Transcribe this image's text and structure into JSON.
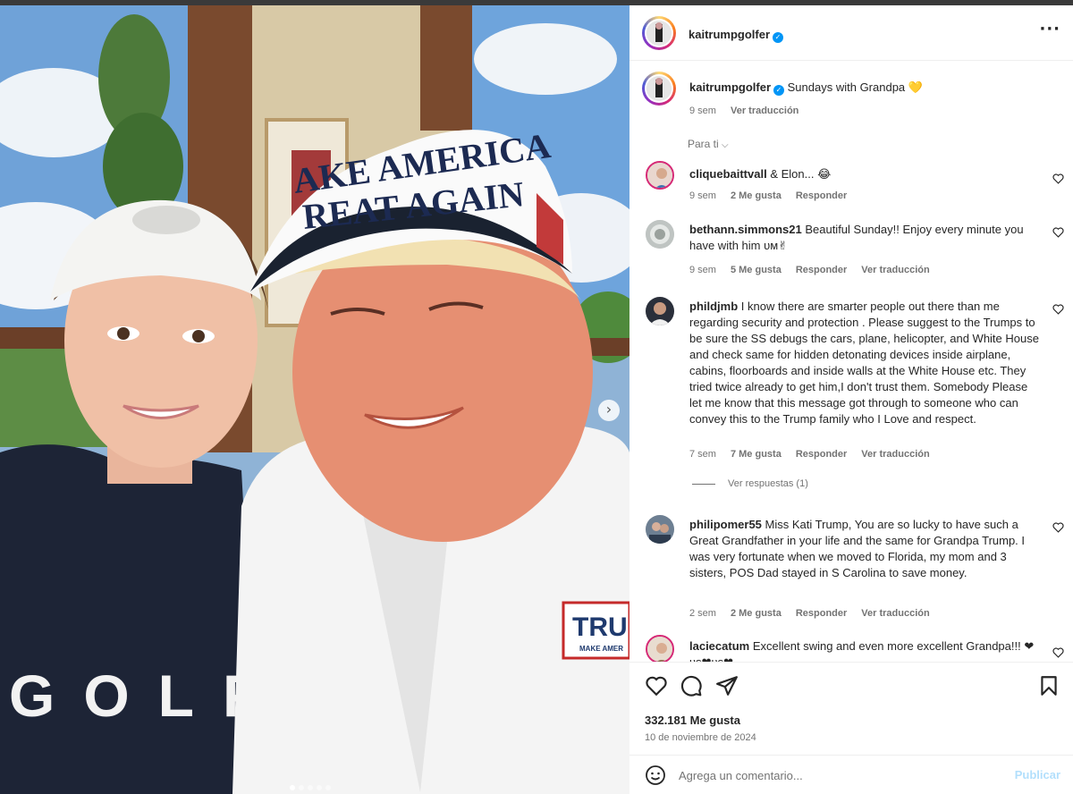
{
  "post": {
    "author": "kaitrumpgolfer",
    "caption": "Sundays with Grandpa 💛",
    "caption_time": "9 sem",
    "see_translation": "Ver traducción",
    "hat_text_line1": "AKE AMERICA",
    "hat_text_line2": "REAT AGAIN",
    "shirt_text": "GOLF",
    "badge_text": "TRU",
    "badge_subtext": "MAKE AMER"
  },
  "sort_label": "Para ti",
  "comments": [
    {
      "user": "cliquebaittvall",
      "text": "& Elon... 😂",
      "time": "9 sem",
      "likes": "2 Me gusta",
      "reply": "Responder",
      "translate": ""
    },
    {
      "user": "bethann.simmons21",
      "text": "Beautiful Sunday!! Enjoy every minute you have with him ᴜᴍ✌",
      "time": "9 sem",
      "likes": "5 Me gusta",
      "reply": "Responder",
      "translate": "Ver traducción"
    },
    {
      "user": "phildjmb",
      "text": "I know there are smarter people out there than me regarding security and protection . Please suggest to the Trumps to be sure the SS debugs the cars, plane, helicopter, and White House and check same for hidden detonating devices inside airplane, cabins, floorboards and inside walls at the White House etc. They tried twice already to get him,I don't trust them. Somebody Please let me know that this message got through to someone who can convey this to the Trump family who I Love and respect.",
      "time": "7 sem",
      "likes": "7 Me gusta",
      "reply": "Responder",
      "translate": "Ver traducción"
    },
    {
      "user": "philipomer55",
      "text": "Miss Kati Trump, You are so lucky to have such a Great Grandfather in your life and the same for Grandpa Trump. I was very fortunate when we moved to Florida, my mom and 3 sisters, POS Dad stayed in S Carolina to save money.",
      "time": "2 sem",
      "likes": "2 Me gusta",
      "reply": "Responder",
      "translate": "Ver traducción"
    },
    {
      "user": "laciecatum",
      "text": "Excellent swing and even more excellent Grandpa!!! ❤ᴜs❤ᴜs❤",
      "time": "",
      "likes": "",
      "reply": "",
      "translate": ""
    }
  ],
  "view_replies": "Ver respuestas (1)",
  "likes_count": "332.181 Me gusta",
  "post_date": "10 de noviembre de 2024",
  "comment_placeholder": "Agrega un comentario...",
  "publish_label": "Publicar",
  "colors": {
    "verified": "#0095f6",
    "publish_disabled": "#b2dffc",
    "muted": "#737373",
    "heart_red": "#ed4956"
  }
}
